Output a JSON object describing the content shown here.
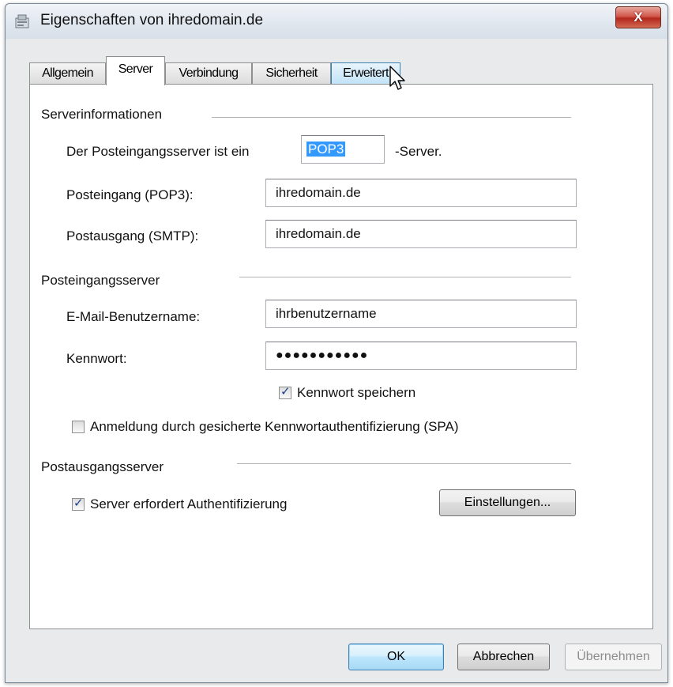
{
  "window": {
    "title": "Eigenschaften von ihredomain.de",
    "close_label": "X"
  },
  "tabs": [
    {
      "label": "Allgemein"
    },
    {
      "label": "Server"
    },
    {
      "label": "Verbindung"
    },
    {
      "label": "Sicherheit"
    },
    {
      "label": "Erweitert"
    }
  ],
  "server_info": {
    "heading": "Serverinformationen",
    "type_label": "Der Posteingangsserver ist ein",
    "type_value": "POP3",
    "type_suffix": "-Server.",
    "incoming_label": "Posteingang (POP3):",
    "incoming_value": "ihredomain.de",
    "outgoing_label": "Postausgang (SMTP):",
    "outgoing_value": "ihredomain.de"
  },
  "incoming_server": {
    "heading": "Posteingangsserver",
    "username_label": "E-Mail-Benutzername:",
    "username_value": "ihrbenutzername",
    "password_label": "Kennwort:",
    "password_value": "●●●●●●●●●●●",
    "save_password_label": "Kennwort speichern",
    "save_password_checked": true,
    "spa_label": "Anmeldung durch gesicherte Kennwortauthentifizierung (SPA)",
    "spa_checked": false
  },
  "outgoing_server": {
    "heading": "Postausgangsserver",
    "auth_label": "Server erfordert Authentifizierung",
    "auth_checked": true,
    "settings_button": "Einstellungen..."
  },
  "footer": {
    "ok": "OK",
    "cancel": "Abbrechen",
    "apply": "Übernehmen"
  },
  "colors": {
    "selection": "#3399ff",
    "close_button": "#c7392c",
    "panel": "#ffffff",
    "window": "#e8eaec"
  },
  "icons": {
    "app": "properties-icon",
    "close": "close-icon",
    "check": "checkmark-icon",
    "cursor": "mouse-pointer-icon"
  }
}
